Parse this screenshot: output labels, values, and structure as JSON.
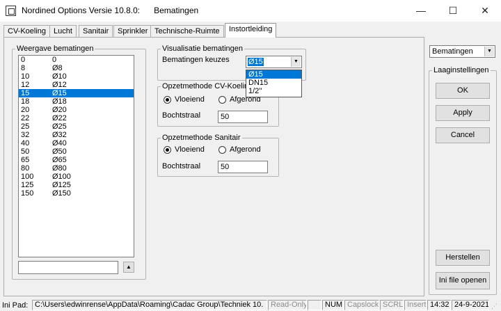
{
  "window": {
    "title": "Nordined Options Versie 10.8.0:",
    "subtitle": "Bematingen",
    "minimize_glyph": "—",
    "maximize_glyph": "☐",
    "close_glyph": "✕"
  },
  "tabs": [
    {
      "label": "CV-Koeling",
      "active": false
    },
    {
      "label": "Lucht",
      "active": false
    },
    {
      "label": "Sanitair",
      "active": false
    },
    {
      "label": "Sprinkler",
      "active": false
    },
    {
      "label": "Technische-Ruimte",
      "active": false
    },
    {
      "label": "Instortleiding",
      "active": true
    }
  ],
  "weergave": {
    "legend": "Weergave bematingen",
    "rows": [
      {
        "size": "0",
        "label": "0"
      },
      {
        "size": "8",
        "label": "Ø8"
      },
      {
        "size": "10",
        "label": "Ø10"
      },
      {
        "size": "12",
        "label": "Ø12"
      },
      {
        "size": "15",
        "label": "Ø15",
        "selected": true
      },
      {
        "size": "18",
        "label": "Ø18"
      },
      {
        "size": "20",
        "label": "Ø20"
      },
      {
        "size": "22",
        "label": "Ø22"
      },
      {
        "size": "25",
        "label": "Ø25"
      },
      {
        "size": "32",
        "label": "Ø32"
      },
      {
        "size": "40",
        "label": "Ø40"
      },
      {
        "size": "50",
        "label": "Ø50"
      },
      {
        "size": "65",
        "label": "Ø65"
      },
      {
        "size": "80",
        "label": "Ø80"
      },
      {
        "size": "100",
        "label": "Ø100"
      },
      {
        "size": "125",
        "label": "Ø125"
      },
      {
        "size": "150",
        "label": "Ø150"
      }
    ],
    "input_value": "",
    "up_glyph": "▲"
  },
  "visualisatie": {
    "legend": "Visualisatie bematingen",
    "label": "Bematingen keuzes",
    "selected": "Ø15",
    "options": [
      "Ø15",
      "DN15",
      "1/2''"
    ]
  },
  "cv": {
    "legend": "Opzetmethode CV-Koeling",
    "radio1": "Vloeiend",
    "radio2": "Afgerond",
    "radius_label": "Bochtstraal",
    "radius_value": "50"
  },
  "sanitair": {
    "legend": "Opzetmethode Sanitair",
    "radio1": "Vloeiend",
    "radio2": "Afgerond",
    "radius_label": "Bochtstraal",
    "radius_value": "50"
  },
  "right": {
    "combo_value": "Bematingen",
    "legend": "Laaginstellingen",
    "ok": "OK",
    "apply": "Apply",
    "cancel": "Cancel",
    "herstellen": "Herstellen",
    "ini_open": "Ini file openen"
  },
  "status": {
    "ini_label": "Ini Pad:",
    "path": "C:\\Users\\edwinrense\\AppData\\Roaming\\Cadac Group\\Techniek 10.",
    "readonly": "Read-Only",
    "num": "NUM",
    "capslock": "Capslock",
    "scrl": "SCRL",
    "insert": "Insert",
    "time": "14:32",
    "date": "24-9-2021"
  }
}
